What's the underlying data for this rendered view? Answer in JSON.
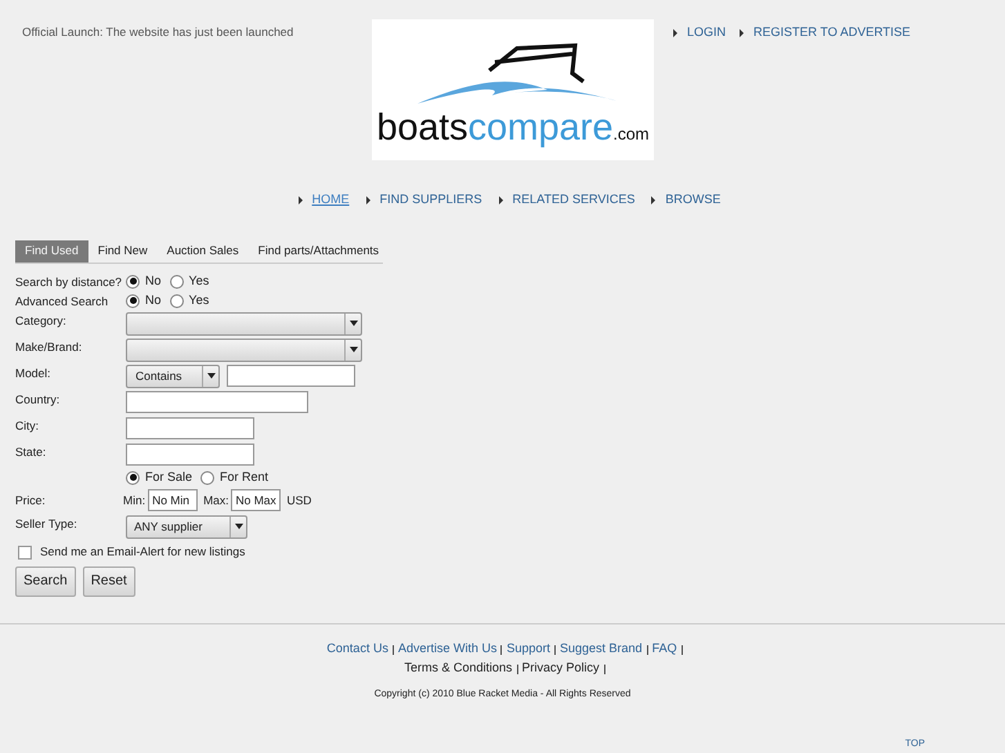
{
  "announcement": "Official Launch: The website has just been launched",
  "account_links": [
    {
      "label": "LOGIN"
    },
    {
      "label": "REGISTER TO ADVERTISE"
    }
  ],
  "logo": {
    "parts": [
      "boats",
      "compare",
      ".com"
    ]
  },
  "nav": [
    {
      "label": "HOME",
      "selected": true
    },
    {
      "label": "FIND SUPPLIERS",
      "selected": false
    },
    {
      "label": "RELATED SERVICES",
      "selected": false
    },
    {
      "label": "BROWSE",
      "selected": false
    }
  ],
  "tabs": [
    {
      "label": "Find Used",
      "selected": true
    },
    {
      "label": "Find New",
      "selected": false
    },
    {
      "label": "Auction Sales",
      "selected": false
    },
    {
      "label": "Find parts/Attachments",
      "selected": false
    }
  ],
  "fields": [
    {
      "kind": "radio",
      "label": "Search by distance?",
      "options": [
        {
          "label": "No",
          "selected": true
        },
        {
          "label": "Yes",
          "selected": false
        }
      ]
    },
    {
      "kind": "radio",
      "label": "Advanced Search",
      "options": [
        {
          "label": "No",
          "selected": true
        },
        {
          "label": "Yes",
          "selected": false
        }
      ]
    },
    {
      "kind": "select",
      "label": "Category:"
    },
    {
      "kind": "select",
      "label": "Make/Brand:"
    },
    {
      "kind": "model",
      "label": "Model:",
      "value": "Contains"
    },
    {
      "kind": "longtext",
      "label": "Country:"
    },
    {
      "kind": "text",
      "label": "City:"
    },
    {
      "kind": "text",
      "label": "State:"
    },
    {
      "kind": "radio",
      "options": [
        {
          "label": "For Sale",
          "selected": true
        },
        {
          "label": "For Rent",
          "selected": false
        }
      ]
    },
    {
      "kind": "price",
      "label": "Price:",
      "min_label": "Min:",
      "min_value": "No Min",
      "max_label": "Max:",
      "max_value": "No Max",
      "currency": "USD"
    },
    {
      "kind": "dropdown",
      "label": "Seller Type:",
      "value": "ANY supplier"
    }
  ],
  "email_alert": {
    "label": "Send me an Email-Alert for new listings",
    "checked": false
  },
  "buttons": [
    "Search",
    "Reset"
  ],
  "footer_links": [
    [
      "Contact Us",
      "Advertise With Us",
      "Support",
      "Suggest Brand",
      "FAQ"
    ],
    [
      "Terms & Conditions",
      "Privacy Policy"
    ]
  ],
  "copyright": "Copyright (c) 2010 Blue Racket Media - All Rights Reserved",
  "top_link": "TOP"
}
